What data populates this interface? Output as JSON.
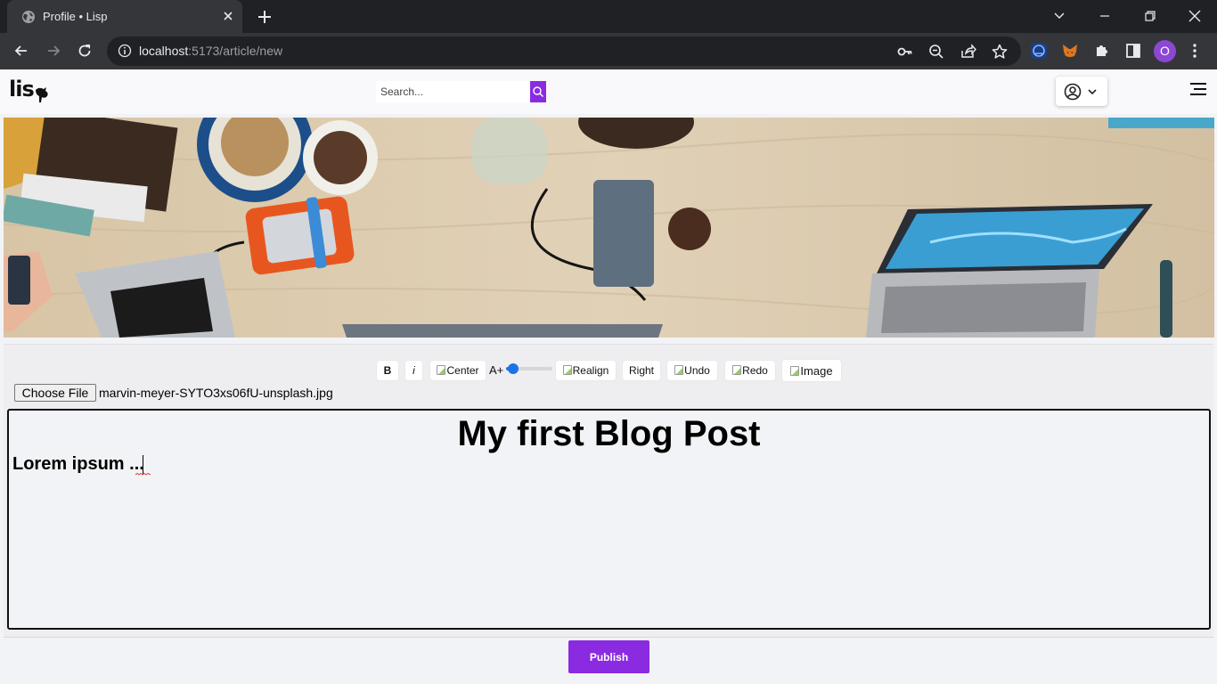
{
  "browser": {
    "tab_title": "Profile • Lisp",
    "url_host": "localhost",
    "url_rest": ":5173/article/new",
    "profile_initial": "O"
  },
  "site": {
    "logo_text": "lis",
    "search_placeholder": "Search..."
  },
  "editor": {
    "tools": {
      "bold": "B",
      "italic": "i",
      "center": "Center",
      "font_size_label": "A+",
      "realign": "Realign",
      "right": "Right",
      "undo": "Undo",
      "redo": "Redo",
      "image": "Image"
    },
    "font_size_level": 0.15,
    "file_button": "Choose File",
    "file_name": "marvin-meyer-SYTO3xs06fU-unsplash.jpg",
    "post_title": "My first Blog Post",
    "post_body": "Lorem ipsum ..."
  },
  "publish_label": "Publish",
  "colors": {
    "accent": "#8a2be2",
    "slider": "#1a73e8"
  },
  "icons": [
    "globe-icon",
    "close-icon",
    "plus-icon",
    "chevron-down-icon",
    "minimize-icon",
    "restore-icon",
    "back-icon",
    "forward-icon",
    "reload-icon",
    "info-icon",
    "key-icon",
    "zoom-out-icon",
    "share-icon",
    "star-icon",
    "extension-icon",
    "metamask-icon",
    "puzzle-icon",
    "side-panel-icon",
    "kebab-menu-icon",
    "search-icon",
    "user-circle-icon",
    "hamburger-icon"
  ]
}
